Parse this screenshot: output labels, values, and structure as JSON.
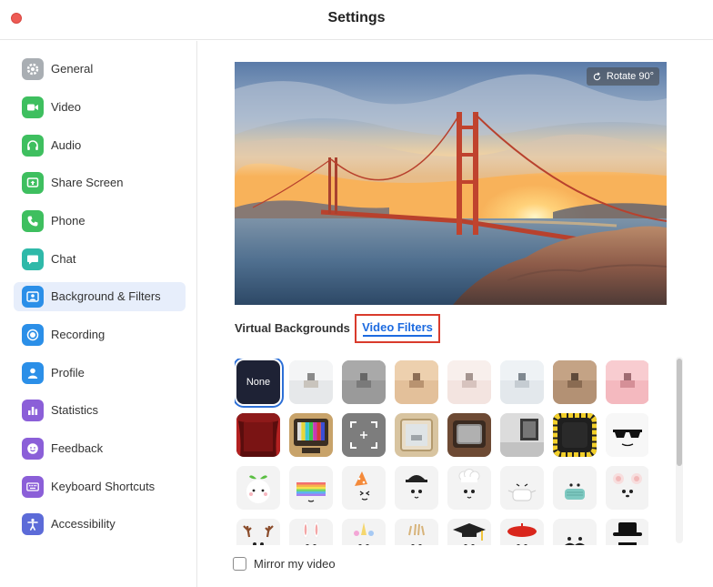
{
  "window": {
    "title": "Settings"
  },
  "sidebar": {
    "items": [
      {
        "label": "General",
        "icon": "gear-icon",
        "color": "#a9aeb3",
        "active": false
      },
      {
        "label": "Video",
        "icon": "video-camera-icon",
        "color": "#3ebf5f",
        "active": false
      },
      {
        "label": "Audio",
        "icon": "headphones-icon",
        "color": "#3ebf5f",
        "active": false
      },
      {
        "label": "Share Screen",
        "icon": "share-screen-icon",
        "color": "#3ebf5f",
        "active": false
      },
      {
        "label": "Phone",
        "icon": "phone-icon",
        "color": "#3ebf5f",
        "active": false
      },
      {
        "label": "Chat",
        "icon": "chat-bubble-icon",
        "color": "#2fb9a9",
        "active": false
      },
      {
        "label": "Background & Filters",
        "icon": "person-background-icon",
        "color": "#2b8fe8",
        "active": true
      },
      {
        "label": "Recording",
        "icon": "record-icon",
        "color": "#2b8fe8",
        "active": false
      },
      {
        "label": "Profile",
        "icon": "profile-icon",
        "color": "#2b8fe8",
        "active": false
      },
      {
        "label": "Statistics",
        "icon": "bar-chart-icon",
        "color": "#8b5fd8",
        "active": false
      },
      {
        "label": "Feedback",
        "icon": "smiley-icon",
        "color": "#8b5fd8",
        "active": false
      },
      {
        "label": "Keyboard Shortcuts",
        "icon": "keyboard-icon",
        "color": "#8b5fd8",
        "active": false
      },
      {
        "label": "Accessibility",
        "icon": "accessibility-icon",
        "color": "#5c6bd8",
        "active": false
      }
    ]
  },
  "preview": {
    "rotate_label": "Rotate 90°"
  },
  "tabs": {
    "virtual_backgrounds": "Virtual Backgrounds",
    "video_filters": "Video Filters",
    "active": "video_filters"
  },
  "filters": {
    "none_label": "None",
    "selected_index": 0,
    "rows": [
      [
        "None",
        "bright-room",
        "gray-room",
        "warm-room",
        "pink-room",
        "cool-room",
        "brown-room",
        "rose-room"
      ],
      [
        "red-theater",
        "retro-tv-color-bars",
        "camera-frame",
        "mirror-frame",
        "vintage-tv",
        "gallery-frame",
        "sunflower-frame",
        "sunglasses"
      ],
      [
        "sprout-face",
        "rainbow-face",
        "party-hat-face",
        "cap-face",
        "chef-face",
        "face-mask",
        "blue-mask",
        "bear-ears"
      ],
      [
        "reindeer-antlers",
        "bunny-ears",
        "unicorn-horn",
        "crown",
        "graduation-cap",
        "red-beret",
        "mustache",
        "black-hat"
      ]
    ]
  },
  "mirror": {
    "label": "Mirror my video",
    "checked": false
  },
  "colors": {
    "accent": "#1d6be0",
    "highlight_box": "#d93b2c",
    "active_nav_bg": "#e7eefb"
  }
}
